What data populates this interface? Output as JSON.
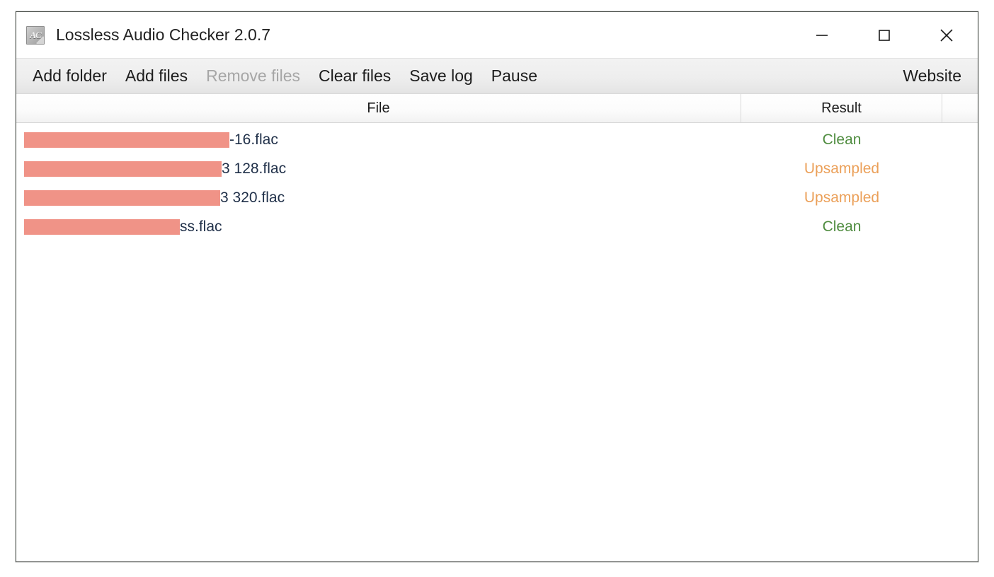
{
  "window": {
    "title": "Lossless Audio Checker 2.0.7",
    "icon_name": "lac-app-icon",
    "icon_glyph": "AC",
    "controls": {
      "minimize": "minimize-icon",
      "maximize": "maximize-icon",
      "close": "close-icon"
    }
  },
  "toolbar": {
    "buttons": [
      {
        "label": "Add folder",
        "enabled": true
      },
      {
        "label": "Add files",
        "enabled": true
      },
      {
        "label": "Remove files",
        "enabled": false
      },
      {
        "label": "Clear files",
        "enabled": true
      },
      {
        "label": "Save log",
        "enabled": true
      },
      {
        "label": "Pause",
        "enabled": true
      }
    ],
    "website_label": "Website"
  },
  "table": {
    "columns": [
      {
        "label": "File"
      },
      {
        "label": "Result"
      },
      {
        "label": ""
      }
    ],
    "rows": [
      {
        "file_redacted_width": 290,
        "file_visible_tail": "-16.flac",
        "result": "Clean",
        "result_color": "#4f8c3f"
      },
      {
        "file_redacted_width": 279,
        "file_visible_tail": "3 128.flac",
        "result": "Upsampled",
        "result_color": "#eba059"
      },
      {
        "file_redacted_width": 277,
        "file_visible_tail": "3 320.flac",
        "result": "Upsampled",
        "result_color": "#eba059"
      },
      {
        "file_redacted_width": 220,
        "file_visible_tail": "ss.flac",
        "result": "Clean",
        "result_color": "#4f8c3f"
      }
    ],
    "redaction_color": "#f09387"
  }
}
